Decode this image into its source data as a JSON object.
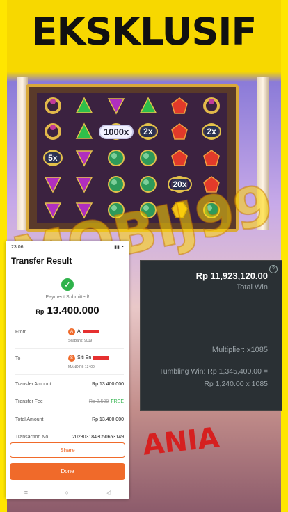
{
  "headline": "EKSKLUSIF",
  "watermark": "MOBIJ99",
  "slot": {
    "rows": [
      [
        "ring",
        "green-triangle",
        "purple-triangle",
        "green-triangle",
        "red-gem",
        "ring"
      ],
      [
        "ring",
        "green-triangle",
        "orb",
        "orb",
        "red-gem",
        "orb"
      ],
      [
        "orb",
        "purple-triangle",
        "orb",
        "orb",
        "red-gem",
        "red-gem"
      ],
      [
        "purple-triangle",
        "purple-triangle",
        "orb",
        "orb",
        "orb",
        "red-gem"
      ],
      [
        "purple-triangle",
        "purple-triangle",
        "orb",
        "orb",
        "yellow-gem",
        "orb"
      ]
    ],
    "multipliers": [
      {
        "label": "1000x",
        "row": 1,
        "col": 2,
        "style": "big"
      },
      {
        "label": "2x",
        "row": 1,
        "col": 3,
        "style": "normal"
      },
      {
        "label": "2x",
        "row": 1,
        "col": 5,
        "style": "normal"
      },
      {
        "label": "5x",
        "row": 2,
        "col": 0,
        "style": "normal"
      },
      {
        "label": "20x",
        "row": 3,
        "col": 4,
        "style": "normal"
      }
    ]
  },
  "phone": {
    "time": "23.06",
    "title": "Transfer Result",
    "status": "Payment Submitted!",
    "currency": "Rp",
    "amount": "13.400.000",
    "from_label": "From",
    "from_name": "Al",
    "from_bank": "SeaBank: 9019",
    "to_label": "To",
    "to_name": "Siti En",
    "to_bank": "MANDIRI: 13400",
    "rows": [
      {
        "label": "Transfer Amount",
        "value": "Rp 13.400.000"
      },
      {
        "label": "Transfer Fee",
        "strike": "Rp 2.500",
        "value": "FREE"
      },
      {
        "label": "Total Amount",
        "value": "Rp 13.400.000"
      },
      {
        "label": "Transaction No.",
        "value": "2023031843050653149"
      }
    ],
    "share_label": "Share",
    "done_label": "Done"
  },
  "win": {
    "total_amount": "Rp 11,923,120.00",
    "total_label": "Total Win",
    "multiplier": "Multiplier: x1085",
    "tumbling": "Tumbling Win: Rp 1,345,400.00 = Rp 1,240.00 x 1085"
  },
  "footer_art": "ANIA",
  "colors": {
    "accent": "#f06a2a",
    "success": "#2eb24a",
    "panel": "#2a3034",
    "frame": "#ffe600"
  }
}
